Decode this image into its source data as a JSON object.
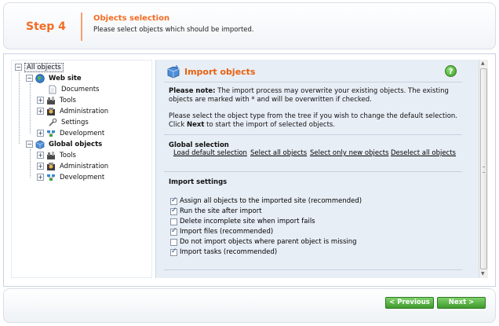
{
  "header": {
    "step": "Step 4",
    "title": "Objects selection",
    "subtitle": "Please select objects which should be imported."
  },
  "tree": {
    "root": "All objects",
    "website": "Web site",
    "website_children": [
      "Documents",
      "Tools",
      "Administration",
      "Settings",
      "Development"
    ],
    "global": "Global objects",
    "global_children": [
      "Tools",
      "Administration",
      "Development"
    ]
  },
  "content": {
    "title": "Import objects",
    "note_label": "Please note:",
    "note_text": " The import process may overwrite your existing objects. The existing objects are marked with * and will be overwritten if checked.",
    "instr_1": "Please select the object type from the tree if you wish to change the default selection.",
    "instr_2_pre": "Click ",
    "instr_2_bold": "Next",
    "instr_2_post": " to start the import of selected objects.",
    "global_selection_title": "Global selection",
    "links": [
      "Load default selection",
      "Select all objects",
      "Select only new objects",
      "Deselect all objects"
    ],
    "import_settings_title": "Import settings",
    "checkboxes": [
      {
        "label": "Assign all objects to the imported site (recommended)",
        "checked": true
      },
      {
        "label": "Run the site after import",
        "checked": true
      },
      {
        "label": "Delete incomplete site when import fails",
        "checked": false
      },
      {
        "label": "Import files (recommended)",
        "checked": true
      },
      {
        "label": "Do not import objects where parent object is missing",
        "checked": false
      },
      {
        "label": "Import tasks (recommended)",
        "checked": true
      }
    ]
  },
  "footer": {
    "previous": "< Previous",
    "next": "Next >"
  },
  "colors": {
    "accent_orange": "#f26c22",
    "button_green": "#3f9a2c",
    "content_bg": "#e8eef6"
  }
}
